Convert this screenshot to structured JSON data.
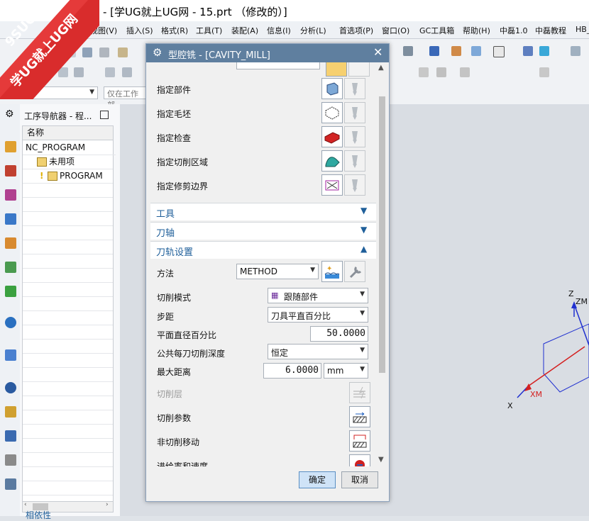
{
  "window": {
    "title": "- [学UG就上UG网 - 15.prt （修改的）]"
  },
  "watermark": {
    "line1": "9SUG",
    "line2": "学UG就上UG网"
  },
  "menu": [
    "视图(V)",
    "插入(S)",
    "格式(R)",
    "工具(T)",
    "装配(A)",
    "信息(I)",
    "分析(L)",
    "首选项(P)",
    "窗口(O)",
    "GC工具箱",
    "帮助(H)",
    "中磊1.0",
    "中磊教程",
    "HB_"
  ],
  "toolbar": {
    "filter_placeholder": "仅在工作部"
  },
  "navigator": {
    "title": "工序导航器 - 程...",
    "column": "名称",
    "rows": [
      "NC_PROGRAM",
      "未用项",
      "PROGRAM"
    ],
    "bottom_label": "相依性"
  },
  "dialog": {
    "title": "型腔铣 - [CAVITY_MILL]",
    "geometry": [
      "指定部件",
      "指定毛坯",
      "指定检查",
      "指定切削区域",
      "指定修剪边界"
    ],
    "sections": {
      "tool": "工具",
      "axis": "刀轴",
      "path": "刀轨设置"
    },
    "method_label": "方法",
    "method_value": "METHOD",
    "cut_pattern_label": "切削模式",
    "cut_pattern_value": "跟随部件",
    "stepover_label": "步距",
    "stepover_value": "刀具平直百分比",
    "flat_pct_label": "平面直径百分比",
    "flat_pct_value": "50.0000",
    "depth_label": "公共每刀切削深度",
    "depth_value": "恒定",
    "max_dist_label": "最大距离",
    "max_dist_value": "6.0000",
    "max_dist_unit": "mm",
    "levels_label": "切削层",
    "cut_params_label": "切削参数",
    "noncut_label": "非切削移动",
    "feeds_label": "进给率和速度",
    "ok": "确定",
    "cancel": "取消"
  },
  "view_axes": {
    "zm": "ZM",
    "z": "Z",
    "xm": "XM",
    "x": "X"
  },
  "colors": {
    "title_bar": "#5f7f9f",
    "section_text": "#1f5f9a",
    "ok_button": "#cfe3f7",
    "axis_red": "#d42020",
    "axis_blue": "#2030d0"
  }
}
